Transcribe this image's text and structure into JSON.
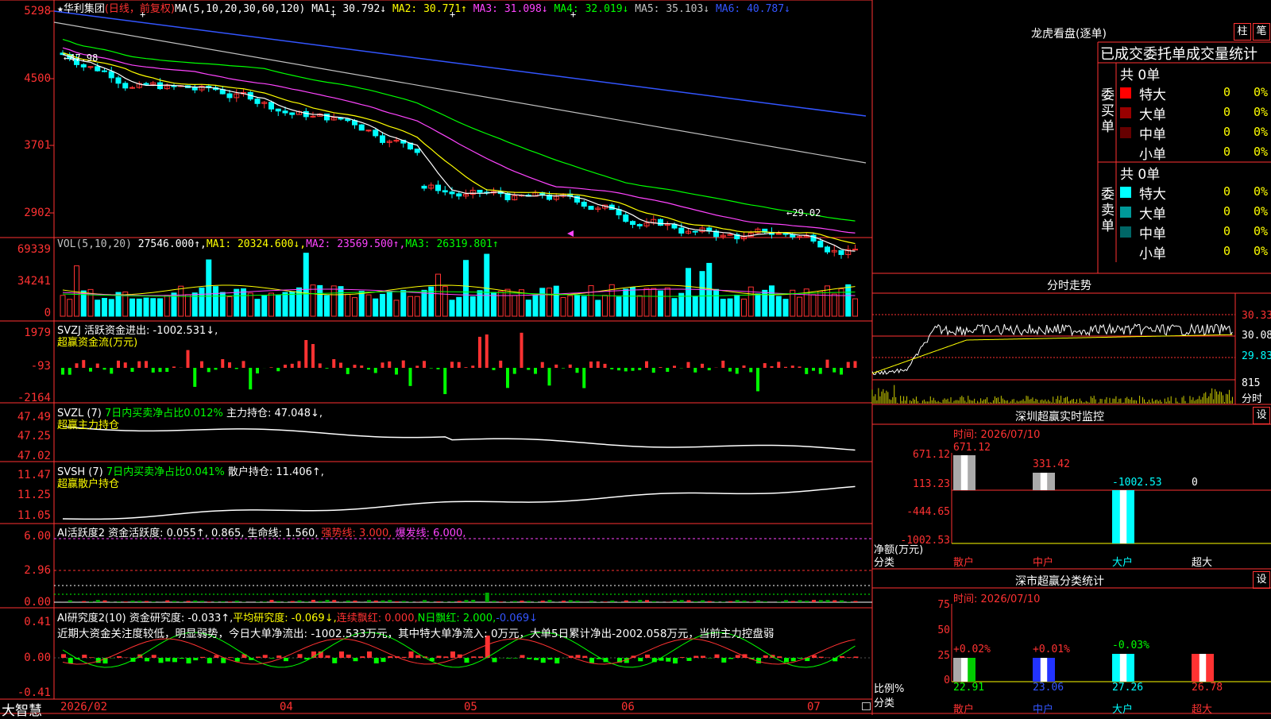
{
  "main": {
    "title_star": "★",
    "stock_name": "华利集团",
    "period": "(日线，前复权)",
    "ma_label": "MA(5,10,20,30,60,120)",
    "ma_values": [
      {
        "label": "MA1:",
        "value": "30.792↓",
        "color": "#ffffff"
      },
      {
        "label": "MA2:",
        "value": "30.771↑",
        "color": "#ffff00"
      },
      {
        "label": "MA3:",
        "value": "31.098↓",
        "color": "#ff44ff"
      },
      {
        "label": "MA4:",
        "value": "32.019↓",
        "color": "#00ff00"
      },
      {
        "label": "MA5:",
        "value": "35.103↓",
        "color": "#c0c0c0"
      },
      {
        "label": "MA6:",
        "value": "40.787↓",
        "color": "#3355ff"
      }
    ],
    "y_ticks": [
      "5298",
      "4500",
      "3701",
      "2902"
    ],
    "high_mark": "←47.98",
    "low_mark": "←29.02"
  },
  "vol": {
    "label": "VOL(5,10,20)",
    "value": "27546.000↑,",
    "ma1": "MA1: 20324.600↓,",
    "ma2": "MA2: 23569.500↑,",
    "ma3": "MA3: 26319.801↑",
    "y_ticks": [
      "69339",
      "34241",
      "0"
    ]
  },
  "svzj": {
    "label": "SVZJ  活跃资金进出: -1002.531↓,",
    "subtitle": "超赢资金流(万元)",
    "y_ticks": [
      "1979",
      "-93",
      "-2164"
    ]
  },
  "svzl": {
    "label": "SVZL (7)",
    "ratio": "7日内买卖净占比0.012%",
    "hold": "主力持仓: 47.048↓,",
    "subtitle": "超赢主力持仓",
    "y_ticks": [
      "47.49",
      "47.25",
      "47.02"
    ]
  },
  "svsh": {
    "label": "SVSH (7)",
    "ratio": "7日内买卖净占比0.041%",
    "hold": "散户持仓: 11.406↑,",
    "subtitle": "超赢散户持仓",
    "y_ticks": [
      "11.47",
      "11.25",
      "11.05"
    ]
  },
  "ai1": {
    "label": "AI活跃度2",
    "active": "资金活跃度: 0.055↑, 0.865,",
    "life": "生命线: 1.560,",
    "strong": "强势线: 3.000,",
    "burst": "爆发线: 6.000,",
    "y_ticks": [
      "6.00",
      "2.96",
      "0.00"
    ]
  },
  "ai2": {
    "label": "AI研究度2(10)",
    "research": "资金研究度: -0.033↑,",
    "avg": "平均研究度: -0.069↓,",
    "cont": "连续飘红: 0.000,",
    "nday": "N日飘红: 2.000,",
    "last": "-0.069↓",
    "comment": "近期大资金关注度较低，明显弱势，今日大单净流出: -1002.533万元，其中特大单净流入: 0万元，大单5日累计净出-2002.058万元，当前主力控盘弱",
    "y_ticks": [
      "0.41",
      "0.00",
      "-0.41"
    ]
  },
  "footer": {
    "brand": "大智慧",
    "months": [
      "2026/02",
      "04",
      "05",
      "06",
      "07"
    ]
  },
  "right": {
    "dragon_title": "龙虎看盘(逐单)",
    "btn_column": "柱",
    "btn_stroke": "笔",
    "stats_title": "已成交委托单成交量统计",
    "buy": {
      "side_label": "委买单",
      "total": "共 0单",
      "rows": [
        {
          "name": "特大",
          "count": "0",
          "pct": "0%",
          "color": "#ff0000"
        },
        {
          "name": "大单",
          "count": "0",
          "pct": "0%",
          "color": "#990000"
        },
        {
          "name": "中单",
          "count": "0",
          "pct": "0%",
          "color": "#660000"
        },
        {
          "name": "小单",
          "count": "0",
          "pct": "0%",
          "color": "#000000"
        }
      ]
    },
    "sell": {
      "side_label": "委卖单",
      "total": "共 0单",
      "rows": [
        {
          "name": "特大",
          "count": "0",
          "pct": "0%",
          "color": "#00ffff"
        },
        {
          "name": "大单",
          "count": "0",
          "pct": "0%",
          "color": "#009999"
        },
        {
          "name": "中单",
          "count": "0",
          "pct": "0%",
          "color": "#006666"
        },
        {
          "name": "小单",
          "count": "0",
          "pct": "0%",
          "color": "#000000"
        }
      ]
    },
    "intraday_title": "分时走势",
    "intraday_ticks": [
      "30.33",
      "30.08",
      "29.83"
    ],
    "intraday_vol": "815",
    "intraday_vol_label": "分时",
    "monitor_title": "深圳超赢实时监控",
    "monitor_btn": "设",
    "monitor_time": "时间: 2026/07/10",
    "monitor_ticks": [
      "671.12",
      "113.23",
      "-444.65",
      "-1002.53"
    ],
    "monitor_values": [
      "671.12",
      "331.42",
      "-1002.53",
      "0"
    ],
    "monitor_axis": "净额(万元)",
    "monitor_axis2": "分类",
    "categories": [
      "散户",
      "中户",
      "大户",
      "超大"
    ],
    "class_title": "深市超赢分类统计",
    "class_btn": "设",
    "class_time": "时间: 2026/07/10",
    "class_ticks": [
      "75",
      "50",
      "25",
      "0"
    ],
    "class_changes": [
      "+0.02%",
      "+0.01%",
      "-0.03%",
      ""
    ],
    "class_values": [
      "22.91",
      "23.06",
      "27.26",
      "26.78"
    ],
    "class_axis": "比例%",
    "class_axis2": "分类"
  },
  "colors": {
    "frame": "#ff3232",
    "up": "#ff3232",
    "down": "#00ffff",
    "bg": "#000000"
  }
}
